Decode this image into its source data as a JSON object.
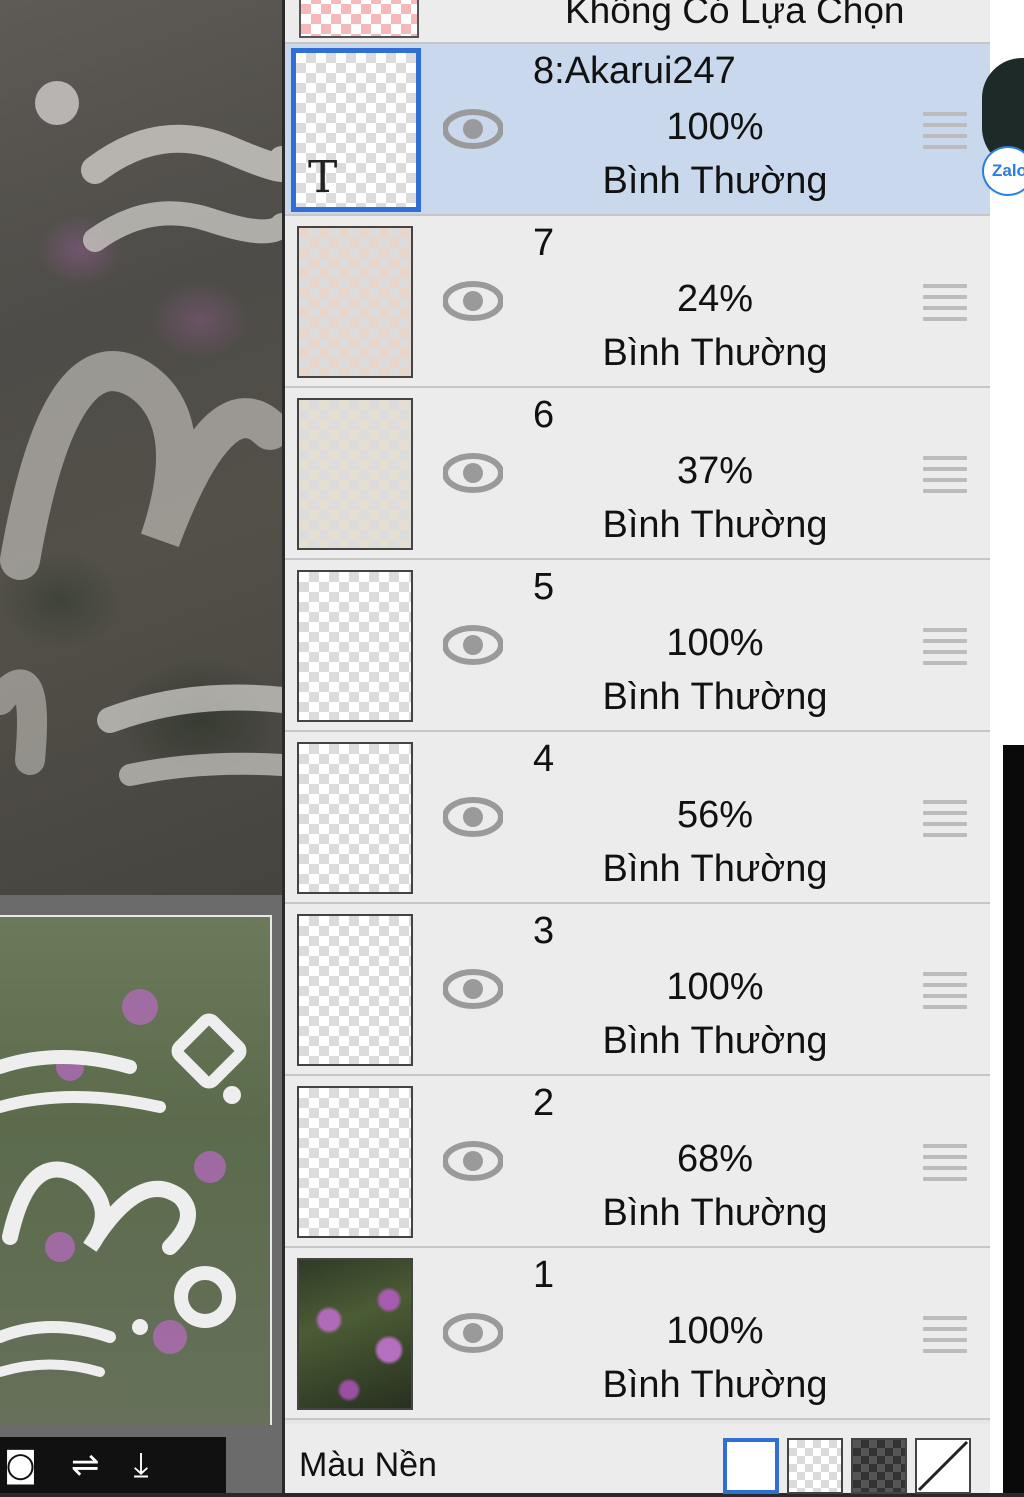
{
  "layers_panel": {
    "top_row_label": "Không Có Lựa Chọn",
    "layers": [
      {
        "name": "8:Akarui247",
        "opacity": "100%",
        "blend": "Bình Thường"
      },
      {
        "name": "7",
        "opacity": "24%",
        "blend": "Bình Thường"
      },
      {
        "name": "6",
        "opacity": "37%",
        "blend": "Bình Thường"
      },
      {
        "name": "5",
        "opacity": "100%",
        "blend": "Bình Thường"
      },
      {
        "name": "4",
        "opacity": "56%",
        "blend": "Bình Thường"
      },
      {
        "name": "3",
        "opacity": "100%",
        "blend": "Bình Thường"
      },
      {
        "name": "2",
        "opacity": "68%",
        "blend": "Bình Thường"
      },
      {
        "name": "1",
        "opacity": "100%",
        "blend": "Bình Thường"
      }
    ],
    "selected_layer": "8:Akarui247",
    "text_layer_marker": "T",
    "background_label": "Màu Nền",
    "background_options": [
      "white",
      "transparent-checker",
      "dark-checker",
      "none"
    ],
    "selected_background": "white"
  },
  "toolbar": {
    "icons": [
      "camera-icon",
      "flip-icon",
      "merge-down-icon"
    ]
  },
  "overlay": {
    "zalo_label": "Zalo"
  },
  "colors": {
    "panel_bg": "#ececec",
    "selected_row": "#c9d8ec",
    "selected_border": "#2f6fd6",
    "eye_icon": "#9a9a9a"
  }
}
